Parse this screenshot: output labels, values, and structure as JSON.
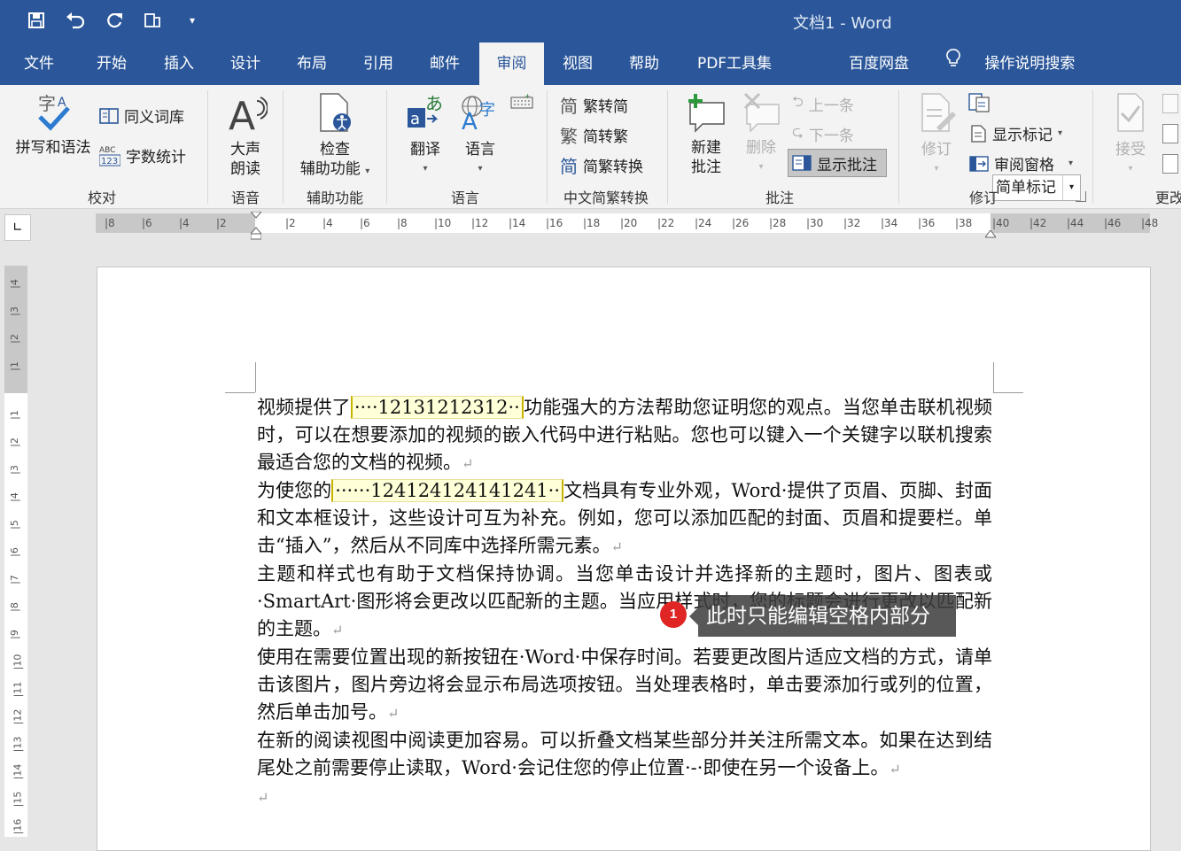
{
  "window": {
    "title": "文档1  -  Word"
  },
  "qat": {
    "save": "save-icon",
    "undo": "undo-icon",
    "redo": "redo-icon",
    "touch": "touch-mode-icon",
    "customize": "▾"
  },
  "tabs": [
    {
      "label": "文件"
    },
    {
      "label": "开始"
    },
    {
      "label": "插入"
    },
    {
      "label": "设计"
    },
    {
      "label": "布局"
    },
    {
      "label": "引用"
    },
    {
      "label": "邮件"
    },
    {
      "label": "审阅",
      "active": true
    },
    {
      "label": "视图"
    },
    {
      "label": "帮助"
    },
    {
      "label": "PDF工具集"
    },
    {
      "label": "百度网盘"
    },
    {
      "label": "操作说明搜索"
    }
  ],
  "ribbon": {
    "proofing": {
      "label": "校对",
      "spelling": "拼写和语法",
      "thesaurus": "同义词库",
      "wordcount": "字数统计"
    },
    "speech": {
      "label": "语音",
      "read_aloud_1": "大声",
      "read_aloud_2": "朗读"
    },
    "accessibility": {
      "label": "辅助功能",
      "check_1": "检查",
      "check_2": "辅助功能"
    },
    "language": {
      "label": "语言",
      "translate": "翻译",
      "language": "语言"
    },
    "chinese": {
      "label": "中文简繁转换",
      "to_simplified": "繁转简",
      "to_traditional": "简转繁",
      "convert": "简繁转换"
    },
    "comments": {
      "label": "批注",
      "new_1": "新建",
      "new_2": "批注",
      "delete": "删除",
      "prev": "上一条",
      "next": "下一条",
      "show": "显示批注"
    },
    "tracking": {
      "label": "修订",
      "track": "修订",
      "markup_combo": "简单标记",
      "show_markup": "显示标记",
      "review_pane": "审阅窗格"
    },
    "changes": {
      "label": "更改",
      "accept": "接受"
    }
  },
  "ruler": {
    "h_ticks": [
      "8",
      "6",
      "4",
      "2",
      "2",
      "4",
      "6",
      "8",
      "10",
      "12",
      "14",
      "16",
      "18",
      "20",
      "22",
      "24",
      "26",
      "28",
      "30",
      "32",
      "34",
      "36",
      "38",
      "40",
      "42",
      "44",
      "46",
      "48"
    ],
    "v_ticks": [
      "4",
      "3",
      "2",
      "1",
      "1",
      "2",
      "3",
      "4",
      "5",
      "6",
      "7",
      "8",
      "9",
      "10",
      "11",
      "12",
      "13",
      "14",
      "15",
      "16"
    ]
  },
  "document": {
    "p1_a": "视频提供了",
    "p1_field": "····12131212312··",
    "p1_b": "功能强大的方法帮助您证明您的观点。当您单击联机视频时，可以在想要添加的视频的嵌入代码中进行粘贴。您也可以键入一个关键字以联机搜索最适合您的文档的视频。",
    "p2_a": "为使您的",
    "p2_field": "······124124124141241··",
    "p2_b": "文档具有专业外观，Word·提供了页眉、页脚、封面和文本框设计，这些设计可互为补充。例如，您可以添加匹配的封面、页眉和提要栏。单击“插入”，然后从不同库中选择所需元素。",
    "p3": "主题和样式也有助于文档保持协调。当您单击设计并选择新的主题时，图片、图表或·SmartArt·图形将会更改以匹配新的主题。当应用样式时，您的标题会进行更改以匹配新的主题。",
    "p4": "使用在需要位置出现的新按钮在·Word·中保存时间。若要更改图片适应文档的方式，请单击该图片，图片旁边将会显示布局选项按钮。当处理表格时，单击要添加行或列的位置，然后单击加号。",
    "p5": "在新的阅读视图中阅读更加容易。可以折叠文档某些部分并关注所需文本。如果在达到结尾处之前需要停止读取，Word·会记住您的停止位置·-·即使在另一个设备上。",
    "para_mark": "↵"
  },
  "callout": {
    "number": "1",
    "text": "此时只能编辑空格内部分"
  },
  "colors": {
    "accent": "#2b579a",
    "ribbon_bg": "#f3f3f3",
    "field_bg": "#ffffd8",
    "badge": "#e02525"
  }
}
